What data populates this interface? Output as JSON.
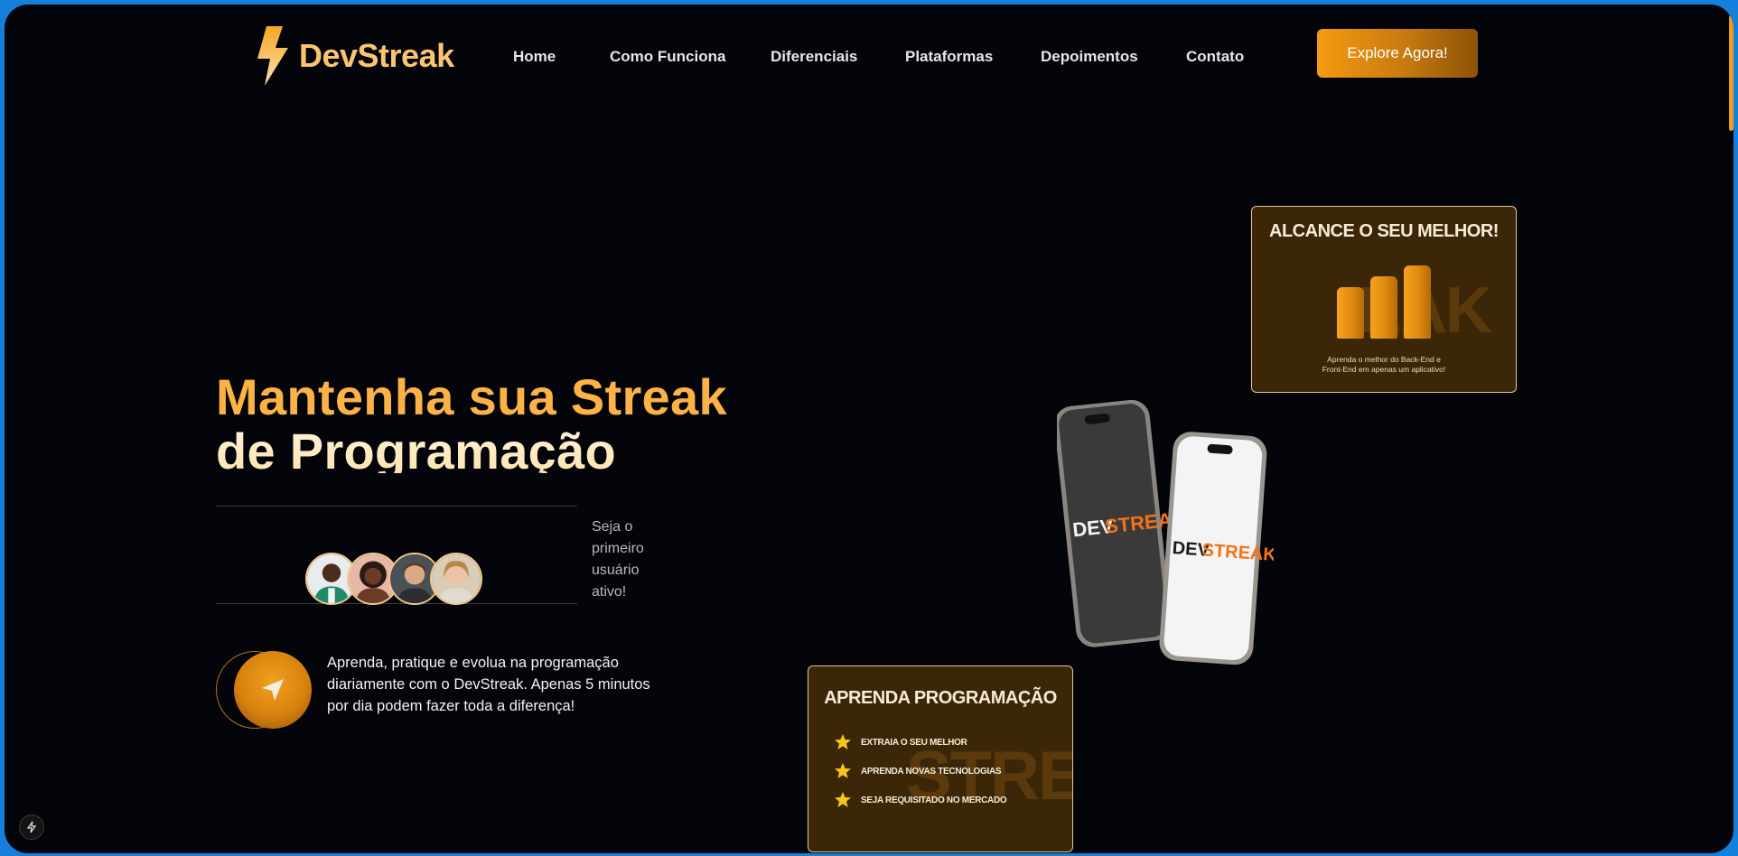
{
  "brand": {
    "name": "DevStreak",
    "accent": "#f5a01a"
  },
  "nav": {
    "items": [
      {
        "label": "Home"
      },
      {
        "label": "Como Funciona"
      },
      {
        "label": "Diferenciais"
      },
      {
        "label": "Plataformas"
      },
      {
        "label": "Depoimentos"
      },
      {
        "label": "Contato"
      }
    ],
    "cta_label": "Explore Agora!"
  },
  "hero": {
    "title_line1": "Mantenha sua Streak",
    "title_line2": "de Programação",
    "side_note": "Seja o primeiro usuário ativo!",
    "description": "Aprenda, pratique e evolua na programação diariamente com o DevStreak. Apenas 5 minutos por dia podem fazer toda a diferença!",
    "avatars": [
      "avatar-1",
      "avatar-2",
      "avatar-3",
      "avatar-4"
    ]
  },
  "card_top": {
    "title": "ALCANCE O SEU MELHOR!",
    "bg_word": "EAK",
    "caption_line1": "Aprenda o melhor do Back-End e",
    "caption_line2": "Front-End em apenas um aplicativo!",
    "bar_levels": [
      0.57,
      0.69,
      0.81
    ]
  },
  "card_bottom": {
    "title": "APRENDA PROGRAMAÇÃO",
    "bg_word": "STREAK",
    "features": [
      "EXTRAIA O SEU MELHOR",
      "APRENDA NOVAS TECNOLOGIAS",
      "SEJA REQUISITADO NO MERCADO"
    ]
  },
  "phones": {
    "left_logo_a": "DEV",
    "left_logo_b": "STREAK",
    "right_logo_a": "DEV",
    "right_logo_b": "STREAK"
  }
}
